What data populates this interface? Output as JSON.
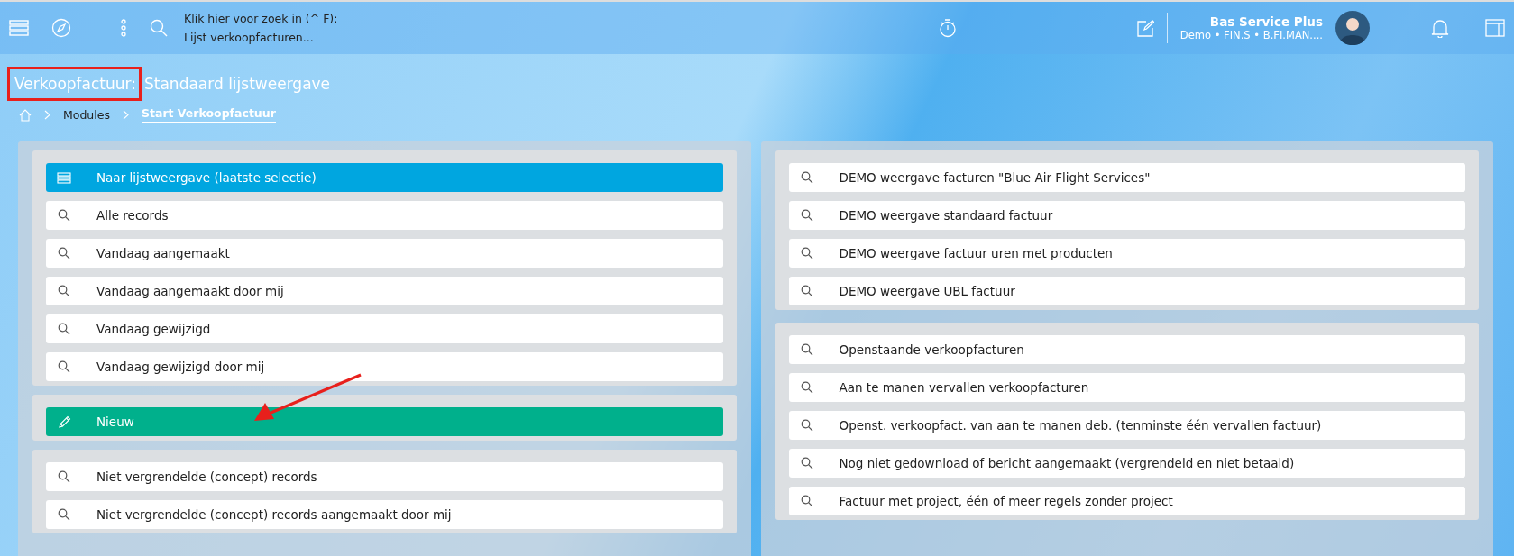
{
  "topbar": {
    "search_hint": "Klik hier voor zoek in (^ F):",
    "search_scope": "Lijst verkoopfacturen...",
    "user_name": "Bas Service Plus",
    "user_context": "Demo • FIN.S • B.FI.MAN...."
  },
  "page": {
    "title_entity": "Verkoopfactuur:",
    "title_view": "Standaard lijstweergave"
  },
  "breadcrumb": [
    {
      "label": "Modules",
      "selected": false
    },
    {
      "label": "Start Verkoopfactuur",
      "selected": true
    }
  ],
  "left_groups": [
    {
      "items": [
        {
          "kind": "list",
          "label": "Naar lijstweergave (laatste selectie)"
        },
        {
          "kind": "search",
          "label": "Alle records"
        },
        {
          "kind": "search",
          "label": "Vandaag aangemaakt"
        },
        {
          "kind": "search",
          "label": "Vandaag aangemaakt door mij"
        },
        {
          "kind": "search",
          "label": "Vandaag gewijzigd"
        },
        {
          "kind": "search",
          "label": "Vandaag gewijzigd door mij"
        }
      ]
    },
    {
      "items": [
        {
          "kind": "new",
          "label": "Nieuw"
        }
      ]
    },
    {
      "items": [
        {
          "kind": "search",
          "label": "Niet vergrendelde (concept) records"
        },
        {
          "kind": "search",
          "label": "Niet vergrendelde (concept) records aangemaakt door mij"
        }
      ]
    }
  ],
  "right_groups": [
    {
      "items": [
        {
          "kind": "search",
          "label": "DEMO weergave facturen \"Blue Air Flight Services\""
        },
        {
          "kind": "search",
          "label": "DEMO weergave standaard factuur"
        },
        {
          "kind": "search",
          "label": "DEMO weergave factuur uren met producten"
        },
        {
          "kind": "search",
          "label": "DEMO weergave UBL factuur"
        }
      ]
    },
    {
      "items": [
        {
          "kind": "search",
          "label": "Openstaande verkoopfacturen"
        },
        {
          "kind": "search",
          "label": "Aan te manen vervallen verkoopfacturen"
        },
        {
          "kind": "search",
          "label": "Openst. verkoopfact. van aan te manen deb. (tenminste één vervallen factuur)"
        },
        {
          "kind": "search",
          "label": "Nog niet gedownload of bericht aangemaakt (vergrendeld en niet betaald)"
        },
        {
          "kind": "search",
          "label": "Factuur met project, één of meer regels zonder project"
        }
      ]
    }
  ]
}
